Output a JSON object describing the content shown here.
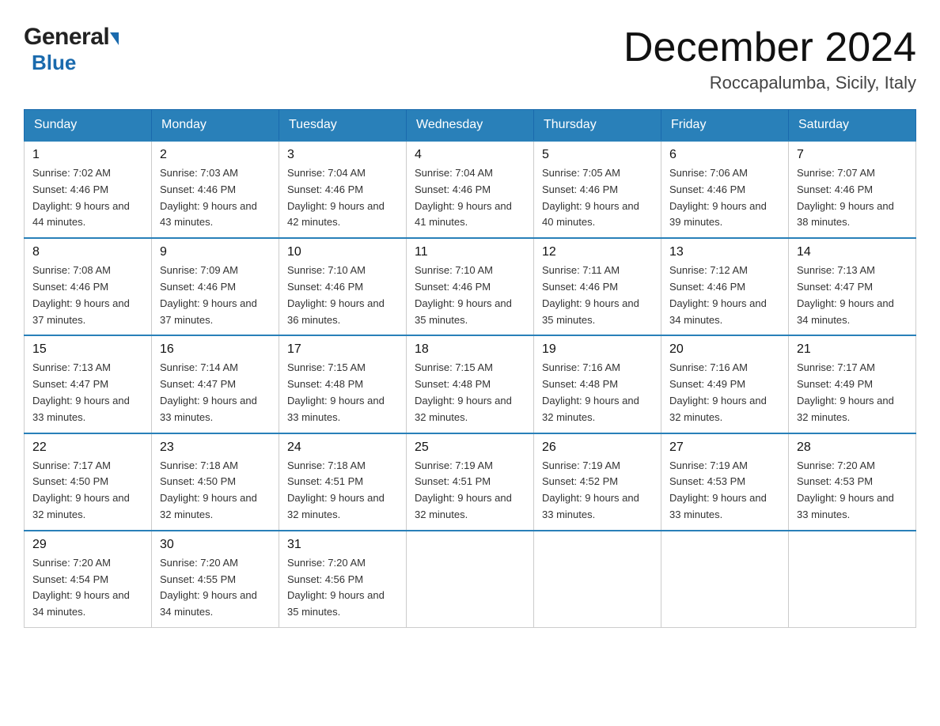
{
  "header": {
    "logo_general": "General",
    "logo_blue": "Blue",
    "month_title": "December 2024",
    "location": "Roccapalumba, Sicily, Italy"
  },
  "weekdays": [
    "Sunday",
    "Monday",
    "Tuesday",
    "Wednesday",
    "Thursday",
    "Friday",
    "Saturday"
  ],
  "weeks": [
    [
      {
        "day": "1",
        "sunrise": "7:02 AM",
        "sunset": "4:46 PM",
        "daylight": "9 hours and 44 minutes."
      },
      {
        "day": "2",
        "sunrise": "7:03 AM",
        "sunset": "4:46 PM",
        "daylight": "9 hours and 43 minutes."
      },
      {
        "day": "3",
        "sunrise": "7:04 AM",
        "sunset": "4:46 PM",
        "daylight": "9 hours and 42 minutes."
      },
      {
        "day": "4",
        "sunrise": "7:04 AM",
        "sunset": "4:46 PM",
        "daylight": "9 hours and 41 minutes."
      },
      {
        "day": "5",
        "sunrise": "7:05 AM",
        "sunset": "4:46 PM",
        "daylight": "9 hours and 40 minutes."
      },
      {
        "day": "6",
        "sunrise": "7:06 AM",
        "sunset": "4:46 PM",
        "daylight": "9 hours and 39 minutes."
      },
      {
        "day": "7",
        "sunrise": "7:07 AM",
        "sunset": "4:46 PM",
        "daylight": "9 hours and 38 minutes."
      }
    ],
    [
      {
        "day": "8",
        "sunrise": "7:08 AM",
        "sunset": "4:46 PM",
        "daylight": "9 hours and 37 minutes."
      },
      {
        "day": "9",
        "sunrise": "7:09 AM",
        "sunset": "4:46 PM",
        "daylight": "9 hours and 37 minutes."
      },
      {
        "day": "10",
        "sunrise": "7:10 AM",
        "sunset": "4:46 PM",
        "daylight": "9 hours and 36 minutes."
      },
      {
        "day": "11",
        "sunrise": "7:10 AM",
        "sunset": "4:46 PM",
        "daylight": "9 hours and 35 minutes."
      },
      {
        "day": "12",
        "sunrise": "7:11 AM",
        "sunset": "4:46 PM",
        "daylight": "9 hours and 35 minutes."
      },
      {
        "day": "13",
        "sunrise": "7:12 AM",
        "sunset": "4:46 PM",
        "daylight": "9 hours and 34 minutes."
      },
      {
        "day": "14",
        "sunrise": "7:13 AM",
        "sunset": "4:47 PM",
        "daylight": "9 hours and 34 minutes."
      }
    ],
    [
      {
        "day": "15",
        "sunrise": "7:13 AM",
        "sunset": "4:47 PM",
        "daylight": "9 hours and 33 minutes."
      },
      {
        "day": "16",
        "sunrise": "7:14 AM",
        "sunset": "4:47 PM",
        "daylight": "9 hours and 33 minutes."
      },
      {
        "day": "17",
        "sunrise": "7:15 AM",
        "sunset": "4:48 PM",
        "daylight": "9 hours and 33 minutes."
      },
      {
        "day": "18",
        "sunrise": "7:15 AM",
        "sunset": "4:48 PM",
        "daylight": "9 hours and 32 minutes."
      },
      {
        "day": "19",
        "sunrise": "7:16 AM",
        "sunset": "4:48 PM",
        "daylight": "9 hours and 32 minutes."
      },
      {
        "day": "20",
        "sunrise": "7:16 AM",
        "sunset": "4:49 PM",
        "daylight": "9 hours and 32 minutes."
      },
      {
        "day": "21",
        "sunrise": "7:17 AM",
        "sunset": "4:49 PM",
        "daylight": "9 hours and 32 minutes."
      }
    ],
    [
      {
        "day": "22",
        "sunrise": "7:17 AM",
        "sunset": "4:50 PM",
        "daylight": "9 hours and 32 minutes."
      },
      {
        "day": "23",
        "sunrise": "7:18 AM",
        "sunset": "4:50 PM",
        "daylight": "9 hours and 32 minutes."
      },
      {
        "day": "24",
        "sunrise": "7:18 AM",
        "sunset": "4:51 PM",
        "daylight": "9 hours and 32 minutes."
      },
      {
        "day": "25",
        "sunrise": "7:19 AM",
        "sunset": "4:51 PM",
        "daylight": "9 hours and 32 minutes."
      },
      {
        "day": "26",
        "sunrise": "7:19 AM",
        "sunset": "4:52 PM",
        "daylight": "9 hours and 33 minutes."
      },
      {
        "day": "27",
        "sunrise": "7:19 AM",
        "sunset": "4:53 PM",
        "daylight": "9 hours and 33 minutes."
      },
      {
        "day": "28",
        "sunrise": "7:20 AM",
        "sunset": "4:53 PM",
        "daylight": "9 hours and 33 minutes."
      }
    ],
    [
      {
        "day": "29",
        "sunrise": "7:20 AM",
        "sunset": "4:54 PM",
        "daylight": "9 hours and 34 minutes."
      },
      {
        "day": "30",
        "sunrise": "7:20 AM",
        "sunset": "4:55 PM",
        "daylight": "9 hours and 34 minutes."
      },
      {
        "day": "31",
        "sunrise": "7:20 AM",
        "sunset": "4:56 PM",
        "daylight": "9 hours and 35 minutes."
      },
      null,
      null,
      null,
      null
    ]
  ]
}
